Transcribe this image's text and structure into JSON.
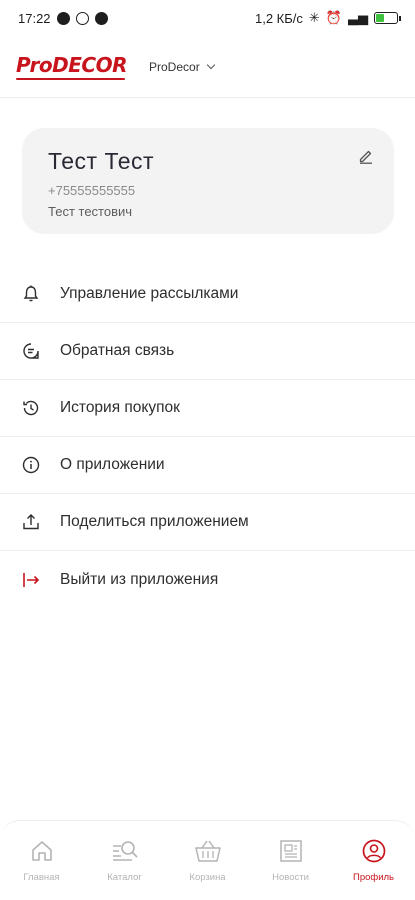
{
  "status_bar": {
    "time": "17:22",
    "speed": "1,2 КБ/с",
    "battery": "40",
    "battery_level": 0.4
  },
  "header": {
    "logo": "ProDECOR",
    "store": "ProDecor"
  },
  "profile": {
    "name": "Тест Тест",
    "phone": "+75555555555",
    "full_name": "Тест тестович"
  },
  "menu": [
    {
      "label": "Управление рассылками",
      "icon": "bell-settings-icon"
    },
    {
      "label": "Обратная связь",
      "icon": "feedback-icon"
    },
    {
      "label": "История покупок",
      "icon": "history-icon"
    },
    {
      "label": "О приложении",
      "icon": "info-icon"
    },
    {
      "label": "Поделиться приложением",
      "icon": "share-icon"
    },
    {
      "label": "Выйти из приложения",
      "icon": "logout-icon"
    }
  ],
  "bottom_nav": [
    {
      "label": "Главная",
      "icon": "home-icon",
      "active": false
    },
    {
      "label": "Каталог",
      "icon": "catalog-search-icon",
      "active": false
    },
    {
      "label": "Корзина",
      "icon": "basket-icon",
      "active": false
    },
    {
      "label": "Новости",
      "icon": "news-icon",
      "active": false
    },
    {
      "label": "Профиль",
      "icon": "profile-icon",
      "active": true
    }
  ],
  "colors": {
    "accent": "#c8141c",
    "inactive": "#b4b4b4",
    "card_bg": "#f3f3f3",
    "text": "#2e2e2e"
  }
}
